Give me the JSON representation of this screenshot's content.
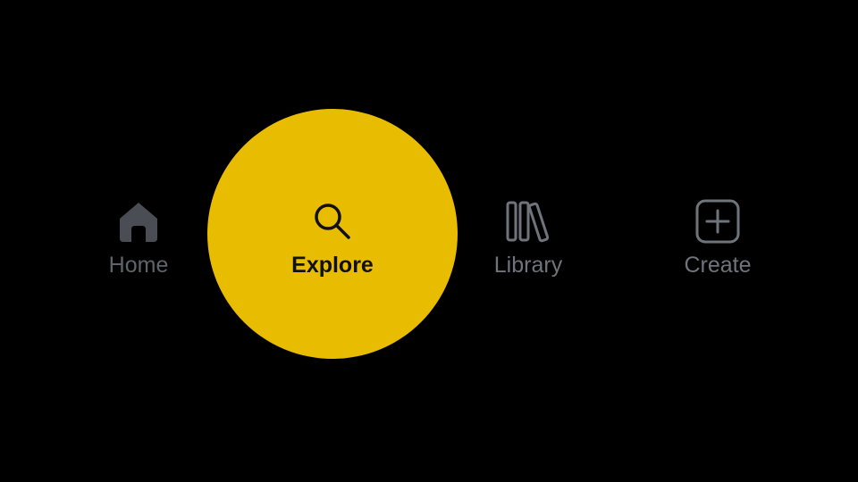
{
  "nav": {
    "active": "Explore",
    "active_color": "#e8bc00",
    "inactive_color": "#6f747c",
    "items": [
      {
        "label": "Home",
        "icon": "home-icon"
      },
      {
        "label": "Explore",
        "icon": "search-icon"
      },
      {
        "label": "Library",
        "icon": "library-icon"
      },
      {
        "label": "Create",
        "icon": "add-square-icon"
      }
    ]
  }
}
